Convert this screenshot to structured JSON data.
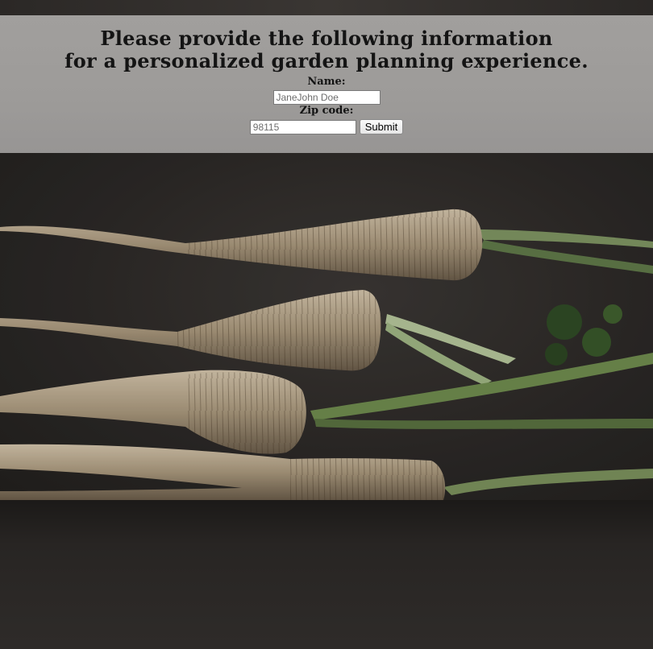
{
  "form": {
    "heading_line1": "Please provide the following information",
    "heading_line2": "for a personalized garden planning experience.",
    "name_label": "Name:",
    "name_value": "JaneJohn Doe",
    "zip_label": "Zip code:",
    "zip_value": "98115",
    "submit_label": "Submit"
  },
  "colors": {
    "panel": "#9f9d9b",
    "background": "#2a2725",
    "text": "#141414"
  }
}
